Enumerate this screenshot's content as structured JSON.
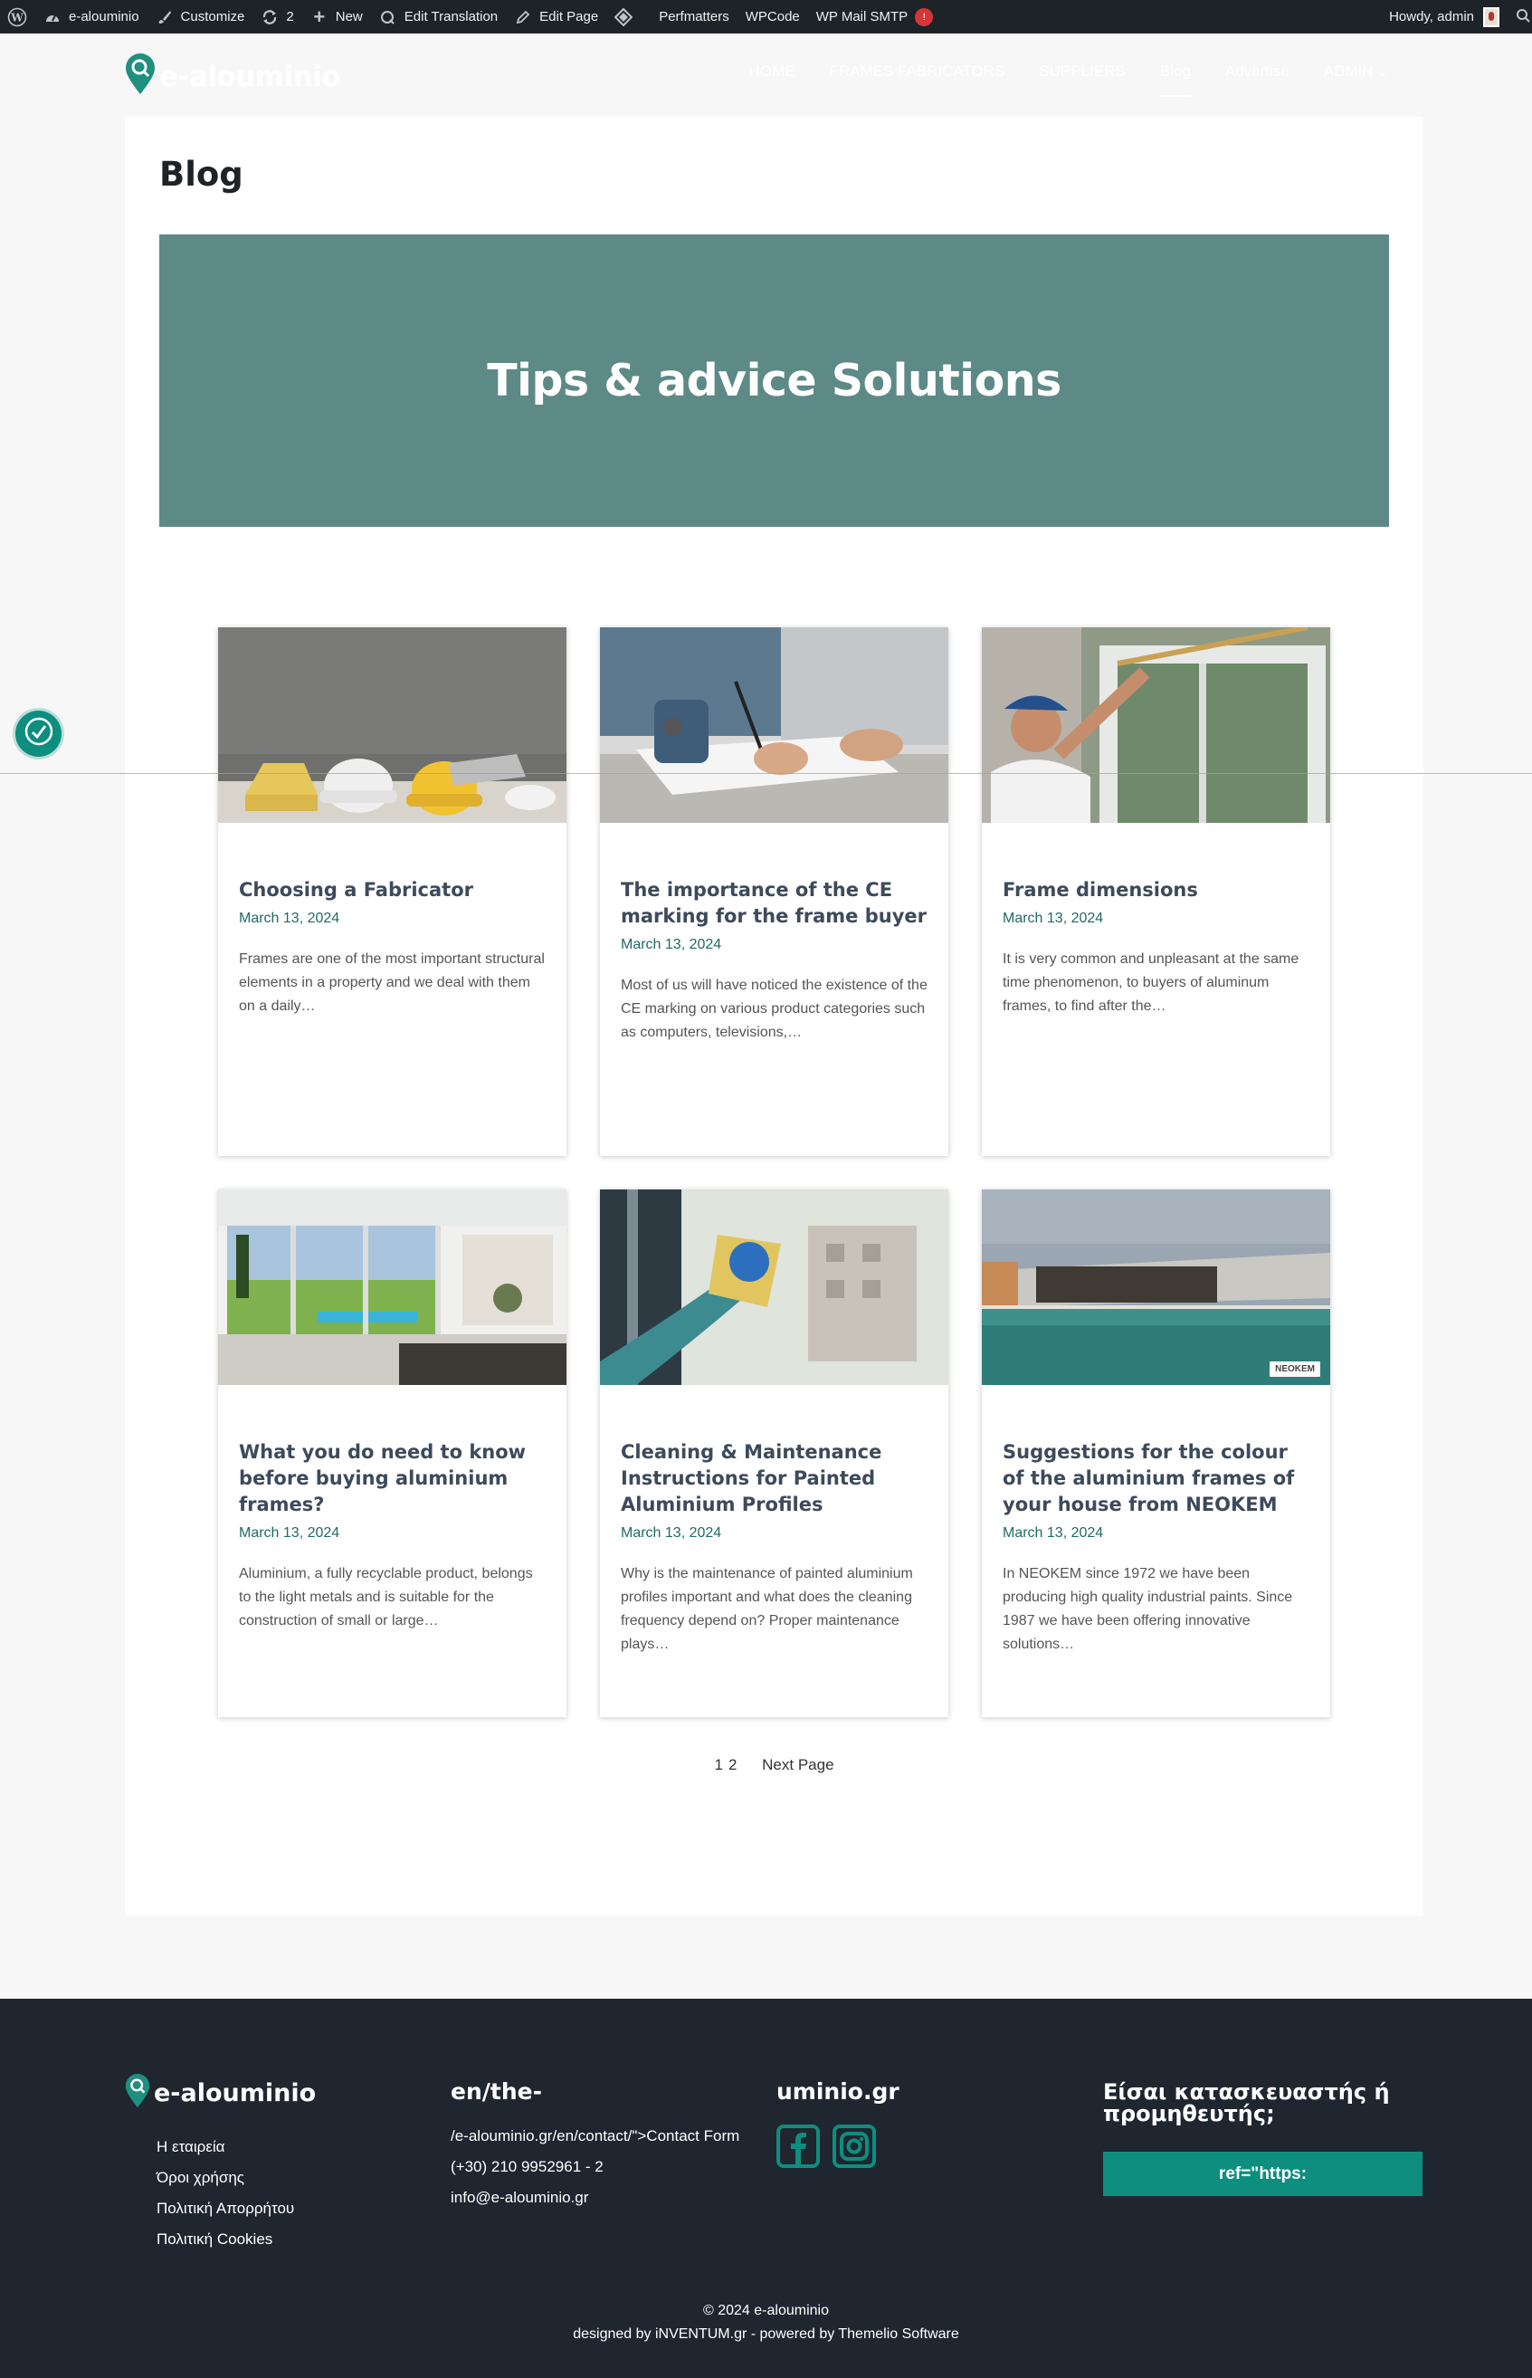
{
  "admin_bar": {
    "items": [
      {
        "icon": "wordpress-icon",
        "label": ""
      },
      {
        "icon": "dashboard-icon",
        "label": "e-alouminio"
      },
      {
        "icon": "brush-icon",
        "label": "Customize"
      },
      {
        "icon": "updates-icon",
        "label": "2"
      },
      {
        "icon": "plus-icon",
        "label": "New"
      },
      {
        "icon": "translate-icon",
        "label": "Edit Translation"
      },
      {
        "icon": "pencil-icon",
        "label": "Edit Page"
      },
      {
        "icon": "diamond-icon",
        "label": ""
      },
      {
        "icon": "",
        "label": "Perfmatters"
      },
      {
        "icon": "",
        "label": "WPCode"
      },
      {
        "icon": "",
        "label": "WP Mail SMTP"
      }
    ],
    "smtp_badge": "!",
    "greeting": "Howdy, admin"
  },
  "site": {
    "logo_text": "e-alouminio"
  },
  "nav": {
    "items": [
      "HOME",
      "FRAMES FABRICATORS",
      "SUPPLIERS",
      "Blog",
      "Advertise",
      "ADMIN"
    ],
    "active": "Blog",
    "admin_caret": "⌄"
  },
  "page": {
    "title": "Blog",
    "hero_title": "Tips & advice Solutions"
  },
  "posts": [
    {
      "title": "Choosing a Fabricator",
      "date": "March 13, 2024",
      "excerpt": "Frames are one of the most important structural elements in a property and we deal with them on a daily…",
      "image": "construction-helmets-image"
    },
    {
      "title": "The importance of the CE marking for the frame buyer",
      "date": "March 13, 2024",
      "excerpt": "Most of us will have noticed the existence of the CE marking on various product categories such as computers, televisions,…",
      "image": "contract-signing-image"
    },
    {
      "title": "Frame dimensions",
      "date": "March 13, 2024",
      "excerpt": "It is very common and unpleasant at the same time phenomenon, to buyers of aluminum frames, to find after the…",
      "image": "measuring-window-image"
    },
    {
      "title": "What you do need to know before buying aluminium frames?",
      "date": "March 13, 2024",
      "excerpt": "Aluminium, a fully recyclable product, belongs to the light metals and is suitable for the construction of small or large…",
      "image": "sliding-doors-pool-image"
    },
    {
      "title": "Cleaning & Maintenance Instructions for Painted Aluminium Profiles",
      "date": "March 13, 2024",
      "excerpt": "Why is the maintenance of painted aluminium profiles important and what does the cleaning frequency depend on? Proper maintenance plays…",
      "image": "window-cleaning-image"
    },
    {
      "title": "Suggestions for the colour of the aluminium frames of your house from NEOKEM",
      "date": "March 13, 2024",
      "excerpt": "In NEOKEM since 1972 we have been producing high quality industrial paints. Since 1987 we have been offering innovative solutions…",
      "image": "villa-pool-image",
      "image_badge": "NEOKEM"
    }
  ],
  "pagination": {
    "page1": "1",
    "page2": "2",
    "next": "Next Page"
  },
  "footer": {
    "logo_text": "e-alouminio",
    "links": [
      "Η εταιρεία",
      "Όροι χρήσης",
      "Πολιτική Απορρήτου",
      "Πολιτική Cookies"
    ],
    "col2_heading": "en/the-",
    "contact": [
      "/e-alouminio.gr/en/contact/\">Contact Form",
      "(+30) 210 9952961 - 2",
      "info@e-alouminio.gr"
    ],
    "col3_heading": "uminio.gr",
    "social": [
      "facebook-icon",
      "instagram-icon"
    ],
    "cta_title": "Είσαι κατασκευαστής ή προμηθευτής;",
    "cta_button": "ref=\"https:",
    "copyright": "© 2024 e-alouminio",
    "credits": "designed by iNVENTUM.gr - powered by Themelio Software"
  },
  "colors": {
    "brand_teal": "#0d8e7e",
    "hero_bg": "#5d8a86",
    "admin_bar": "#1d2327",
    "footer_bg": "#1f2630",
    "date_color": "#1f6b63"
  }
}
